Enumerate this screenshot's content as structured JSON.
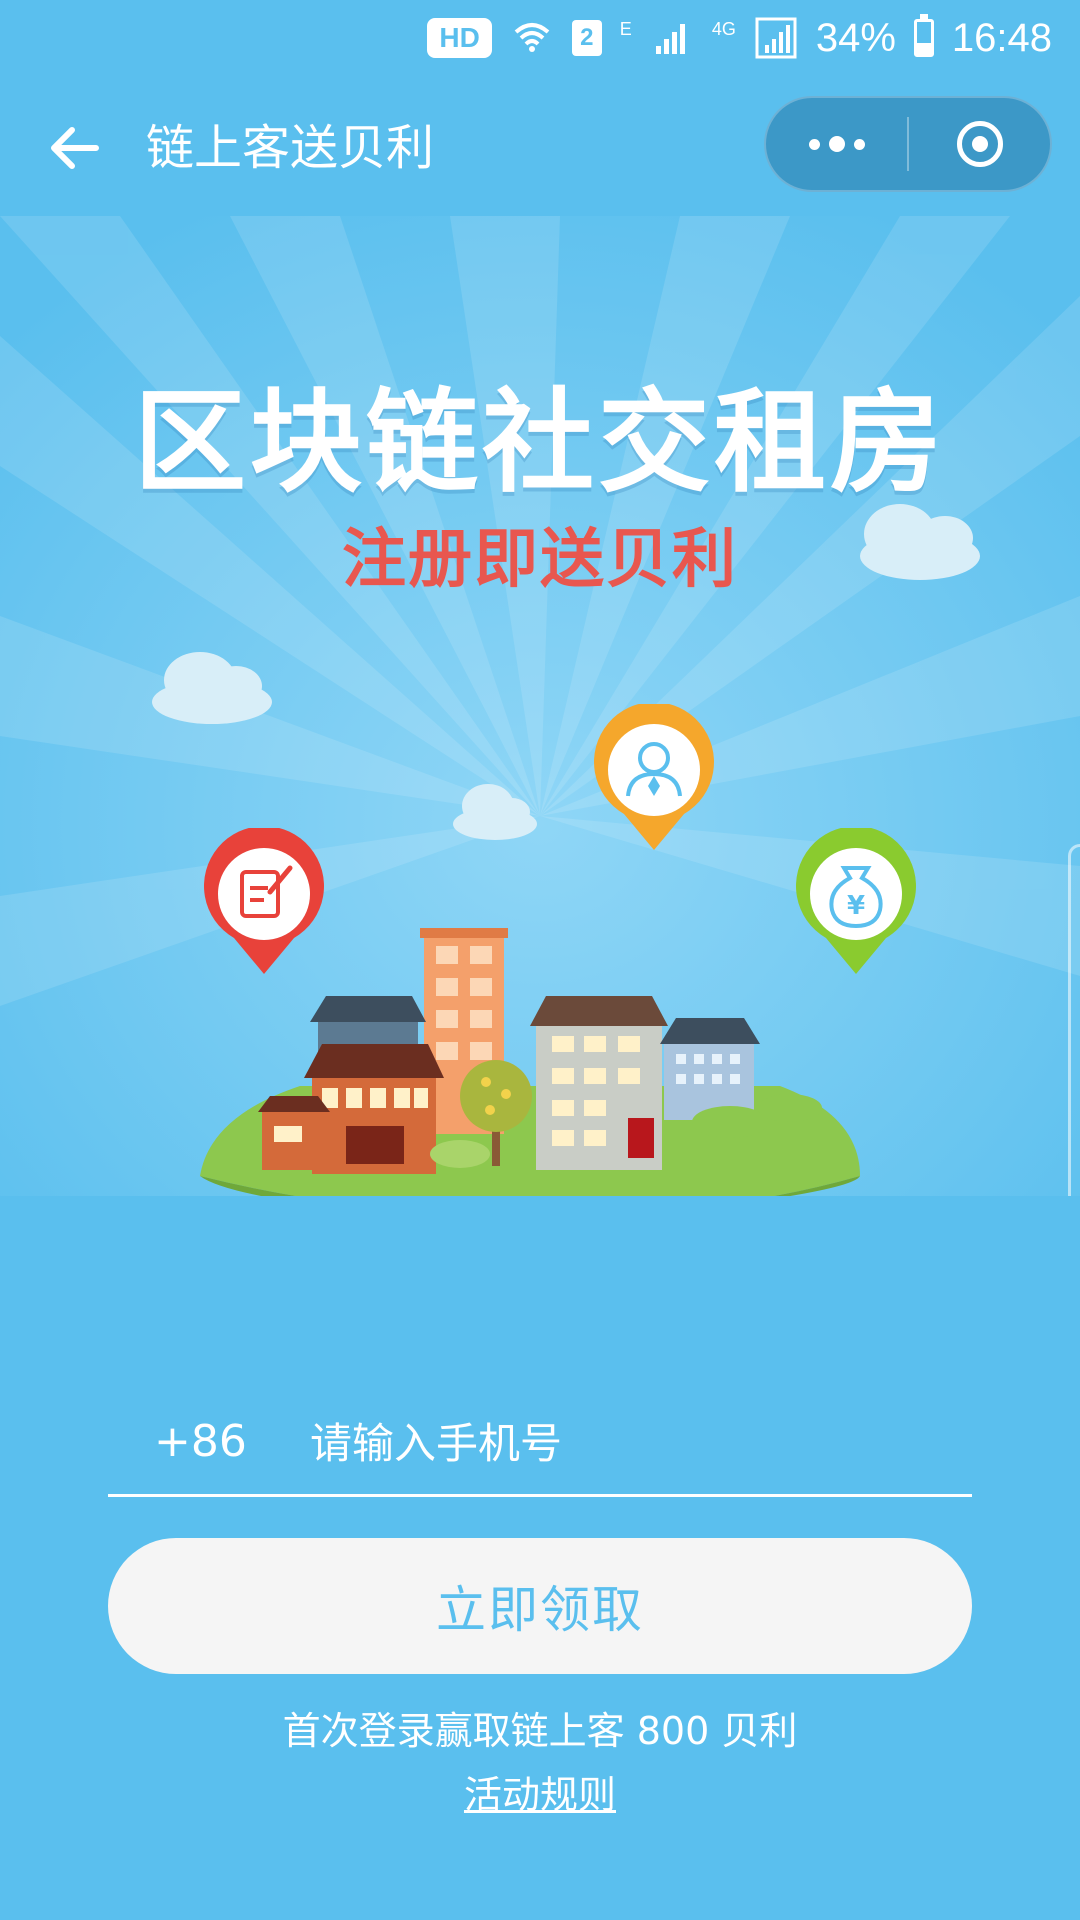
{
  "status_bar": {
    "hd_label": "HD",
    "sim_slot": "2",
    "network_e": "E",
    "network_4g": "4G",
    "battery_percent": "34%",
    "time": "16:48",
    "icons": [
      "wifi-icon",
      "signal-icon",
      "battery-icon"
    ]
  },
  "navbar": {
    "title": "链上客送贝利",
    "back_icon": "arrow-left-icon",
    "more_icon": "more-dots-icon",
    "close_icon": "target-icon"
  },
  "banner": {
    "headline": "区块链社交租房",
    "subline": "注册即送贝利",
    "icons": [
      "edit-pin-icon",
      "user-pin-icon",
      "money-bag-pin-icon"
    ],
    "money_symbol": "¥"
  },
  "form": {
    "country_code": "+86",
    "phone_placeholder": "请输入手机号",
    "phone_value": "",
    "submit_label": "立即领取"
  },
  "footer": {
    "tip": "首次登录赢取链上客 800 贝利",
    "rules_link": "活动规则"
  },
  "colors": {
    "background": "#5ABFEE",
    "headline_accent": "#E8574F",
    "button_bg": "#F5F5F5",
    "button_text": "#5ABFEE"
  }
}
